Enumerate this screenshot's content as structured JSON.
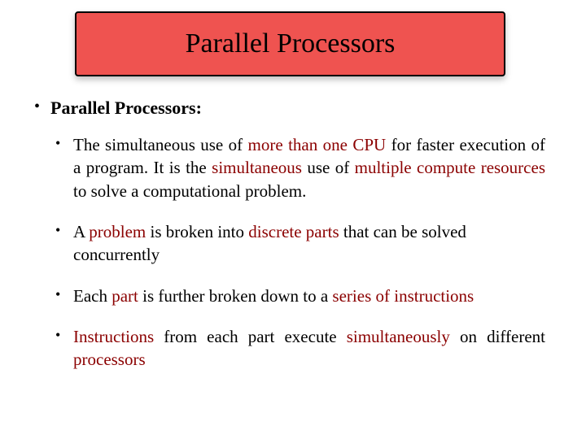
{
  "title": "Parallel Processors",
  "heading": "Parallel Processors:",
  "bullets": {
    "b1": {
      "pre": "The simultaneous use of ",
      "k1": "more than one CPU",
      "mid1": " for faster execution of a program. It is the ",
      "k2": "simultaneous",
      "mid2": " use of ",
      "k3": "multiple compute resources",
      "post": " to solve a computational problem."
    },
    "b2": {
      "pre": "A ",
      "k1": "problem",
      "mid1": " is broken into ",
      "k2": "discrete parts",
      "post": " that can be solved concurrently"
    },
    "b3": {
      "pre": "Each ",
      "k1": "part",
      "mid1": " is further broken down to a ",
      "k2": "series of instructions",
      "post": ""
    },
    "b4": {
      "k1": "Instructions",
      "mid1": " from each part execute ",
      "k2": "simultaneously",
      "mid2": " on different ",
      "k3": "processors",
      "post": ""
    }
  }
}
